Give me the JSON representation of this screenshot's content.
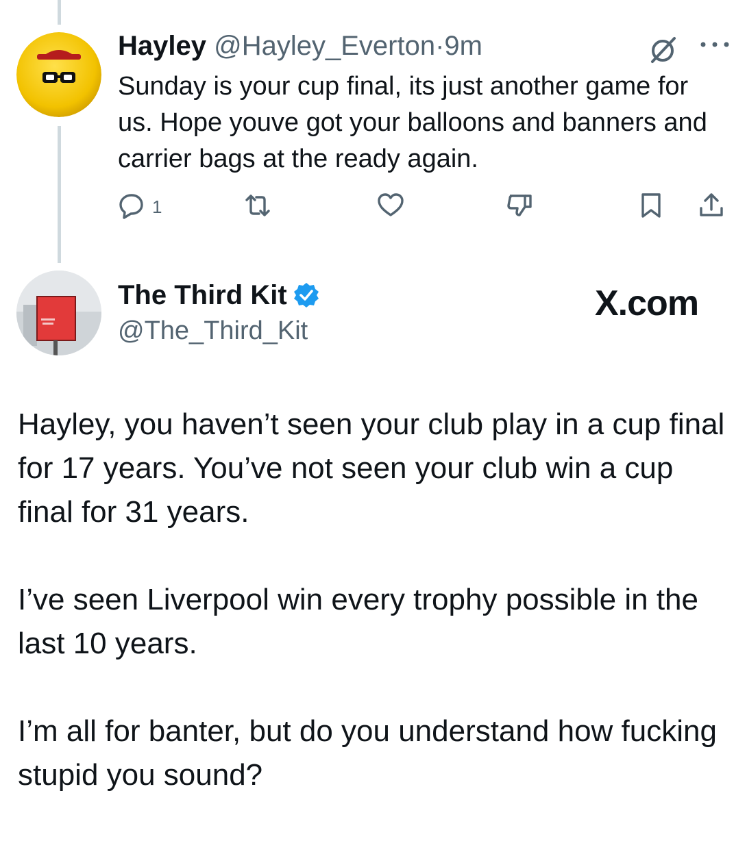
{
  "tweet1": {
    "name": "Hayley",
    "handle": "@Hayley_Everton",
    "separator": "·",
    "time": "9m",
    "text": "Sunday is your cup final, its just another game for us. Hope youve got your balloons and banners and carrier bags at the ready again.",
    "reply_count": "1",
    "icons": [
      "grok-icon",
      "more-icon",
      "reply-icon",
      "retweet-icon",
      "like-icon",
      "dislike-icon",
      "bookmark-icon",
      "share-icon"
    ]
  },
  "tweet2": {
    "name": "The Third Kit",
    "handle": "@The_Third_Kit",
    "watermark": "X.com",
    "paragraphs": [
      "Hayley, you haven’t seen your club play in a cup final for 17 years. You’ve not seen your club win a cup final for 31 years.",
      "I’ve seen Liverpool win every trophy possible in the last 10 years.",
      "I’m all for banter, but do you understand how fucking stupid you sound?"
    ]
  },
  "colors": {
    "text": "#0f1419",
    "muted": "#536471",
    "thread_line": "#cfd9de",
    "verified": "#1d9bf0",
    "avatar_yellow": "#f2c200"
  }
}
